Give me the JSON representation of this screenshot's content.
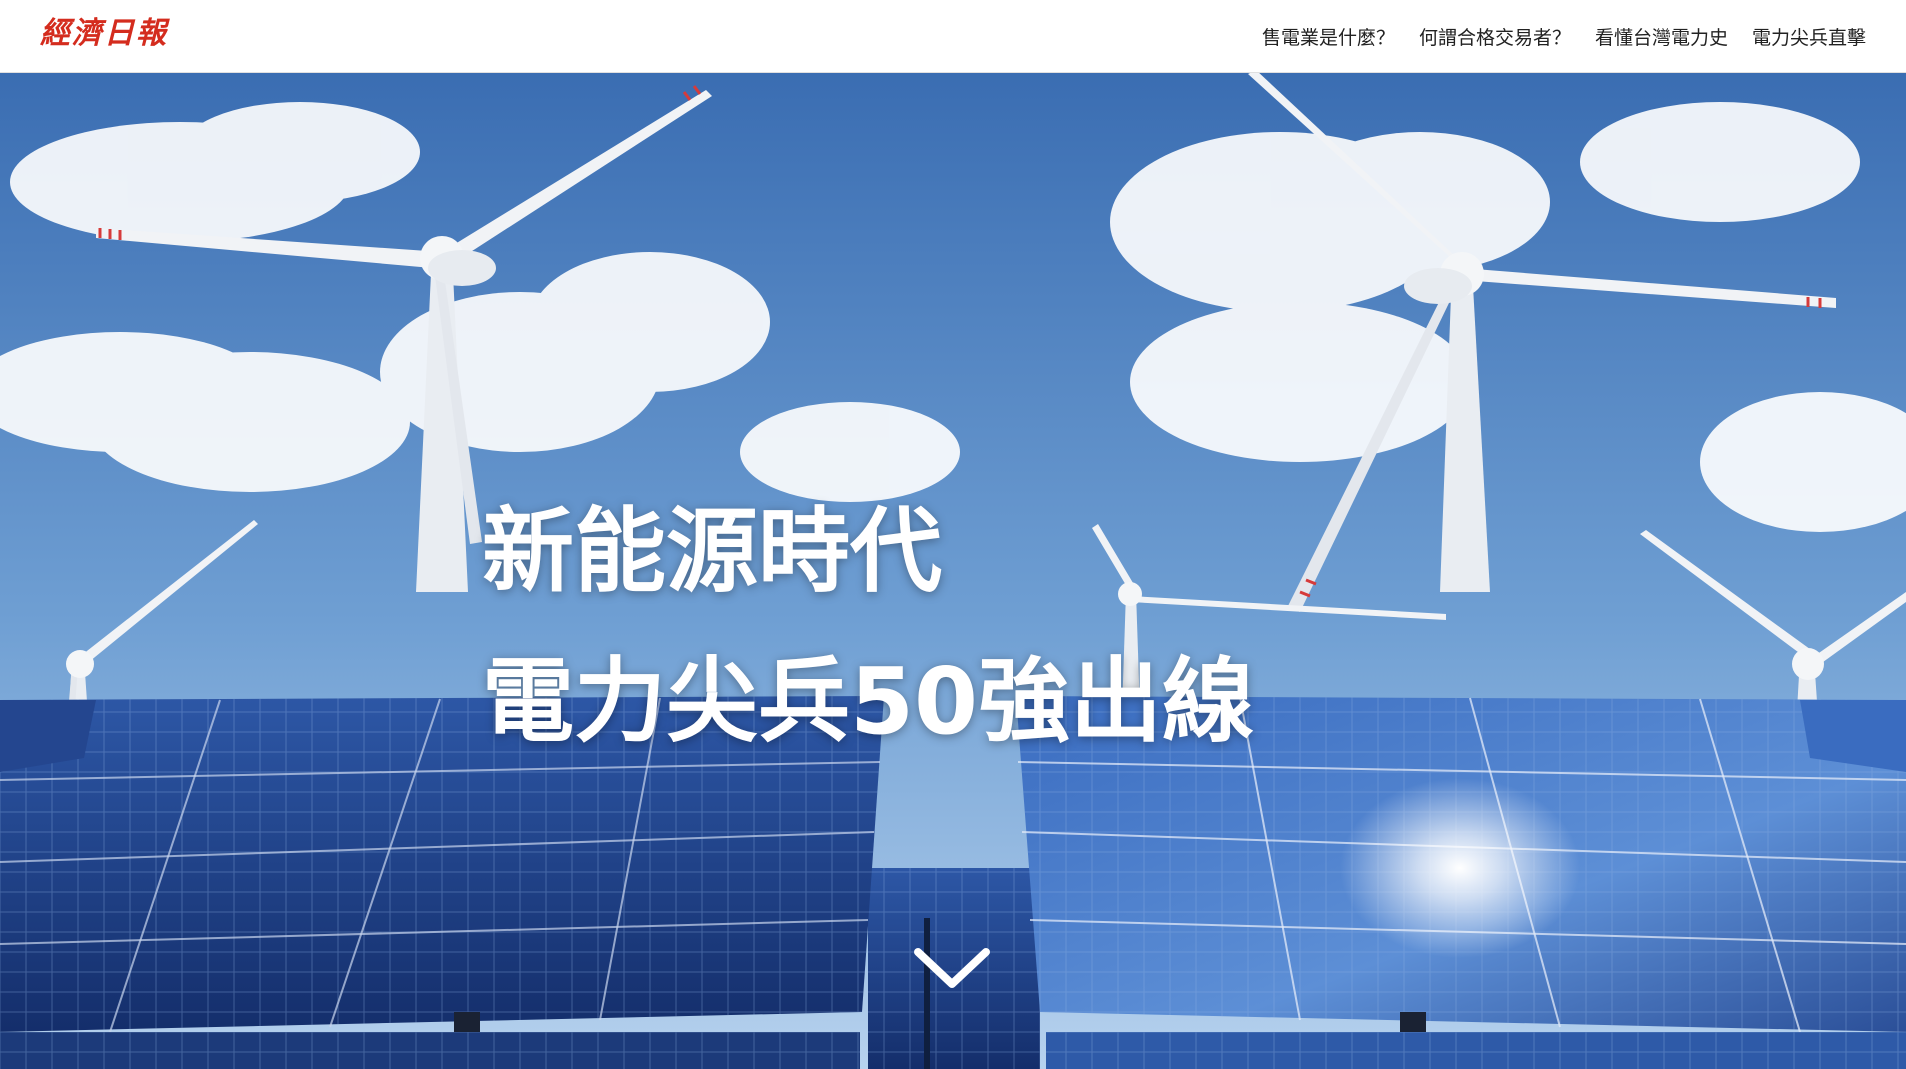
{
  "brand": {
    "logo_text": "經濟日報",
    "color": "#d42c1e"
  },
  "nav": {
    "items": [
      {
        "label": "售電業是什麼？"
      },
      {
        "label": "何謂合格交易者？"
      },
      {
        "label": "看懂台灣電力史"
      },
      {
        "label": "電力尖兵直擊"
      }
    ]
  },
  "hero": {
    "headline_line1": "新能源時代",
    "headline_line2": "電力尖兵50強出線",
    "scroll_icon": "chevron-down-icon",
    "background": "wind-turbines-and-solar-panels-photo"
  },
  "colors": {
    "sky_top": "#3c6fb4",
    "sky_bottom": "#a9c9ea",
    "panel": "#1e3f86",
    "text": "#ffffff"
  }
}
